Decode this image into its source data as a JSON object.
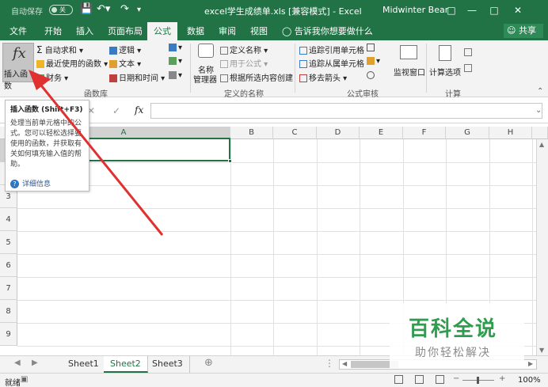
{
  "titlebar": {
    "autosave_label": "自动保存",
    "autosave_state": "关",
    "document_title": "excel学生成绩单.xls  [兼容模式]  -  Excel",
    "user_name": "Midwinter Bear"
  },
  "ribbon_tabs": [
    "文件",
    "开始",
    "插入",
    "页面布局",
    "公式",
    "数据",
    "审阅",
    "视图"
  ],
  "active_tab": "公式",
  "tell_me": "告诉我你想要做什么",
  "share_label": "共享",
  "function_library": {
    "insert_function": "插入函数",
    "autosum": "自动求和",
    "recently_used": "最近使用的函数",
    "financial": "财务",
    "logical": "逻辑",
    "text": "文本",
    "date_time": "日期和时间",
    "group_label": "函数库"
  },
  "defined_names": {
    "name_manager_line1": "名称",
    "name_manager_line2": "管理器",
    "define_name": "定义名称",
    "use_in_formula": "用于公式",
    "create_from_selection": "根据所选内容创建",
    "group_label": "定义的名称"
  },
  "formula_auditing": {
    "trace_precedents": "追踪引用单元格",
    "trace_dependents": "追踪从属单元格",
    "remove_arrows": "移去箭头",
    "watch_window": "监视窗口",
    "group_label": "公式审核"
  },
  "calculation": {
    "calc_options": "计算选项",
    "group_label": "计算"
  },
  "tooltip": {
    "title": "插入函数 (Shift+F3)",
    "body": "处理当前单元格中的公式。您可以轻松选择要使用的函数，并获取有关如何填充输入值的帮助。",
    "more_info": "详细信息"
  },
  "columns": [
    "A",
    "B",
    "C",
    "D",
    "E",
    "F",
    "G",
    "H"
  ],
  "rows": [
    "1",
    "2",
    "3",
    "4",
    "5",
    "6",
    "7",
    "8",
    "9"
  ],
  "sheets": [
    "Sheet1",
    "Sheet2",
    "Sheet3"
  ],
  "active_sheet": "Sheet2",
  "status": {
    "ready": "就绪",
    "zoom": "100%"
  },
  "watermark": {
    "title": "百科全说",
    "subtitle": "助你轻松解决"
  },
  "colors": {
    "excel_green": "#217346",
    "annotation_arrow": "#e03030",
    "watermark_green": "#2e9d4d"
  }
}
